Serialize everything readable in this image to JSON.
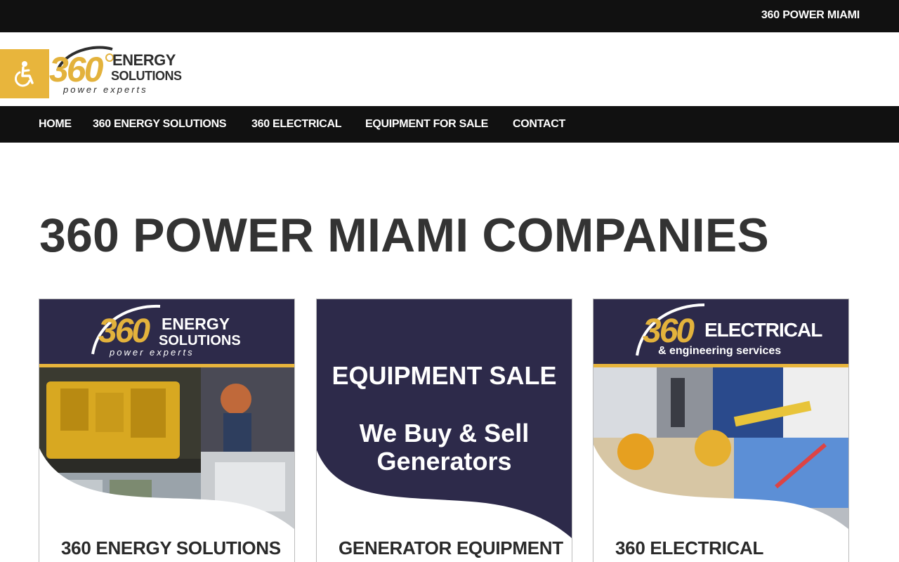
{
  "topbar": {
    "site_name": "360 POWER MIAMI"
  },
  "logo": {
    "number": "360",
    "line1": "ENERGY",
    "line2": "SOLUTIONS",
    "tagline": "power experts"
  },
  "nav": {
    "items": [
      {
        "label": "HOME"
      },
      {
        "label": "360 ENERGY SOLUTIONS"
      },
      {
        "label": "360 ELECTRICAL"
      },
      {
        "label": "EQUIPMENT FOR SALE"
      },
      {
        "label": "CONTACT"
      }
    ]
  },
  "page": {
    "title": "360 POWER MIAMI COMPANIES"
  },
  "cards": [
    {
      "banner": {
        "number": "360",
        "line1": "ENERGY",
        "line2": "SOLUTIONS",
        "tagline": "power experts"
      },
      "title": "360 ENERGY SOLUTIONS"
    },
    {
      "banner": {
        "headline": "EQUIPMENT SALE",
        "sub1": "We Buy & Sell",
        "sub2": "Generators"
      },
      "title": "GENERATOR EQUIPMENT"
    },
    {
      "banner": {
        "number": "360",
        "line1": "ELECTRICAL",
        "tagline": "& engineering services"
      },
      "title": "360 ELECTRICAL"
    }
  ],
  "colors": {
    "dark_bar": "#111111",
    "accent_gold": "#e8b53c",
    "banner_navy": "#2d2a4a"
  },
  "icons": {
    "accessibility": "wheelchair-icon"
  }
}
